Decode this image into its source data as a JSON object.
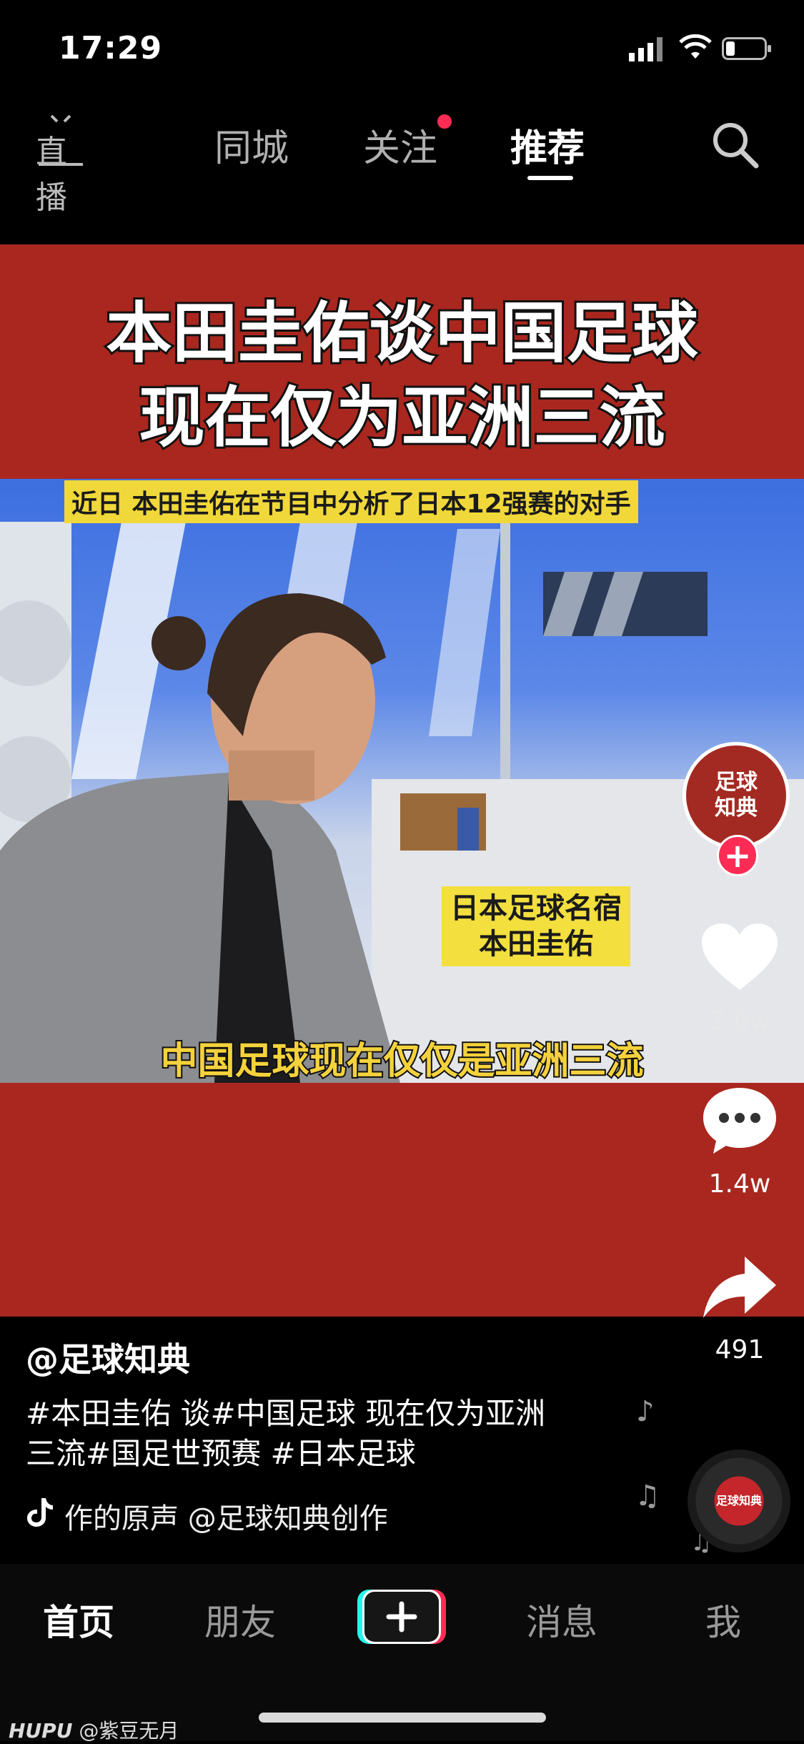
{
  "status_bar": {
    "time": "17:29"
  },
  "top_nav": {
    "live_label": "直播",
    "tabs": [
      {
        "label": "同城"
      },
      {
        "label": "关注"
      },
      {
        "label": "推荐"
      }
    ],
    "active_tab": "推荐"
  },
  "video": {
    "title_line1": "本田圭佑谈中国足球",
    "title_line2": "现在仅为亚洲三流",
    "caption_top": "近日 本田圭佑在节目中分析了日本12强赛的对手",
    "caption_name_line1": "日本足球名宿",
    "caption_name_line2": "本田圭佑",
    "caption_bottom": "中国足球现在仅仅是亚洲三流"
  },
  "actions": {
    "avatar_text_line1": "足球",
    "avatar_text_line2": "知典",
    "likes": "2.6w",
    "comments": "1.4w",
    "shares": "491"
  },
  "post": {
    "author": "@足球知典",
    "description_line1": "#本田圭佑 谈#中国足球 现在仅为亚洲",
    "description_line2": "三流#国足世预赛 #日本足球",
    "music": "作的原声    @足球知典创作",
    "disc_label": "足球知典"
  },
  "bottom_tabs": {
    "home": "首页",
    "friends": "朋友",
    "messages": "消息",
    "me": "我"
  },
  "watermark": {
    "brand": "HUPU",
    "user": "@紫豆无月"
  },
  "colors": {
    "accent": "#fe2c55",
    "video_bg": "#a9271f",
    "caption_yellow": "#f3df3e"
  }
}
